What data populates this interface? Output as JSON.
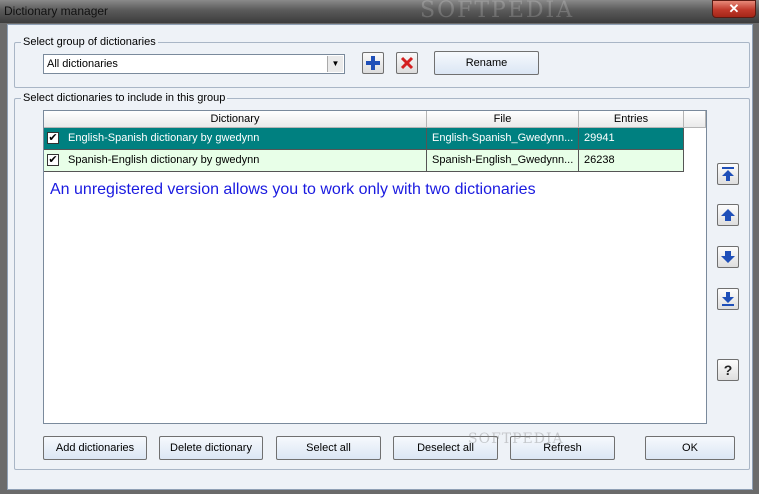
{
  "window": {
    "title": "Dictionary manager",
    "close_label": "✕",
    "watermark": "SOFTPEDIA"
  },
  "group": {
    "legend": "Select group of dictionaries",
    "selected": "All dictionaries",
    "rename_label": "Rename"
  },
  "include": {
    "legend": "Select dictionaries to include in this group",
    "columns": [
      "Dictionary",
      "File",
      "Entries"
    ],
    "rows": [
      {
        "checked": true,
        "dictionary": "English-Spanish dictionary by gwedynn",
        "file": "English-Spanish_Gwedynn...",
        "entries": "29941"
      },
      {
        "checked": true,
        "dictionary": "Spanish-English dictionary by gwedynn",
        "file": "Spanish-English_Gwedynn...",
        "entries": "26238"
      }
    ],
    "notice": "An unregistered version allows you to work only with two dictionaries"
  },
  "buttons": {
    "add": "Add dictionaries",
    "delete": "Delete dictionary",
    "select_all": "Select all",
    "deselect_all": "Deselect all",
    "refresh": "Refresh",
    "ok": "OK"
  },
  "watermark_bottom": "SOFTPEDIA",
  "colors": {
    "selected_row": "#008080",
    "second_row": "#e8ffe8",
    "notice": "#1a1ae0"
  }
}
